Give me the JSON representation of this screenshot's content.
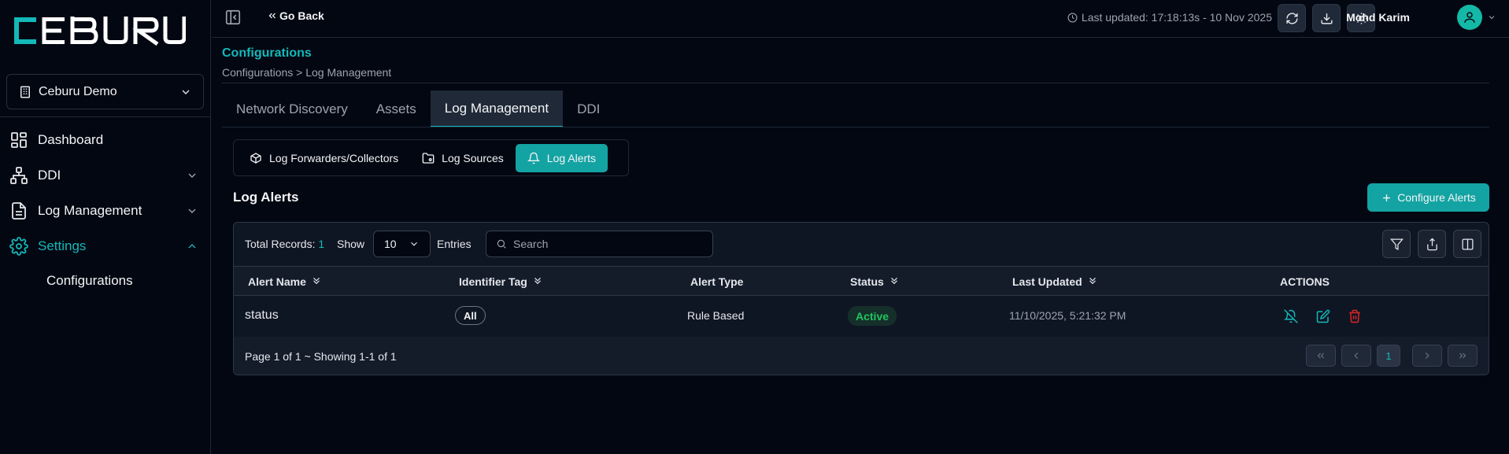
{
  "app": {
    "logo_text": "CEBURU"
  },
  "sidebar": {
    "org": "Ceburu Demo",
    "items": [
      {
        "label": "Dashboard",
        "icon": "dashboard-icon"
      },
      {
        "label": "DDI",
        "icon": "network-icon"
      },
      {
        "label": "Log Management",
        "icon": "file-icon"
      },
      {
        "label": "Settings",
        "icon": "gear-icon",
        "active": true
      }
    ],
    "sub_items": [
      "Configurations"
    ]
  },
  "topbar": {
    "go_back": "Go Back",
    "last_updated": "Last updated: 17:18:13s - 10 Nov 2025",
    "user_name": "Mohd Karim"
  },
  "header": {
    "title": "Configurations",
    "breadcrumb": "Configurations > Log Management"
  },
  "tabs": [
    {
      "label": "Network Discovery"
    },
    {
      "label": "Assets"
    },
    {
      "label": "Log Management",
      "active": true
    },
    {
      "label": "DDI"
    }
  ],
  "subtabs": [
    {
      "label": "Log Forwarders/Collectors",
      "icon": "box-icon"
    },
    {
      "label": "Log Sources",
      "icon": "folder-icon"
    },
    {
      "label": "Log Alerts",
      "icon": "bell-icon",
      "active": true
    }
  ],
  "section": {
    "title": "Log Alerts",
    "configure_button": "Configure Alerts"
  },
  "table": {
    "total_label": "Total Records:",
    "total_count": "1",
    "show_label": "Show",
    "page_size": "10",
    "entries_label": "Entries",
    "search_placeholder": "Search",
    "columns": [
      "Alert Name",
      "Identifier Tag",
      "Alert Type",
      "Status",
      "Last Updated",
      "ACTIONS"
    ],
    "rows": [
      {
        "alert_name": "status",
        "identifier_tag": "All",
        "alert_type": "Rule Based",
        "status": "Active",
        "last_updated": "11/10/2025, 5:21:32 PM"
      }
    ],
    "page_info": "Page 1 of 1 ~ Showing 1-1 of 1",
    "current_page": "1"
  },
  "colors": {
    "accent": "#14b8b8",
    "background": "#030712",
    "status_active": "#22c55e",
    "danger": "#dc2626"
  }
}
